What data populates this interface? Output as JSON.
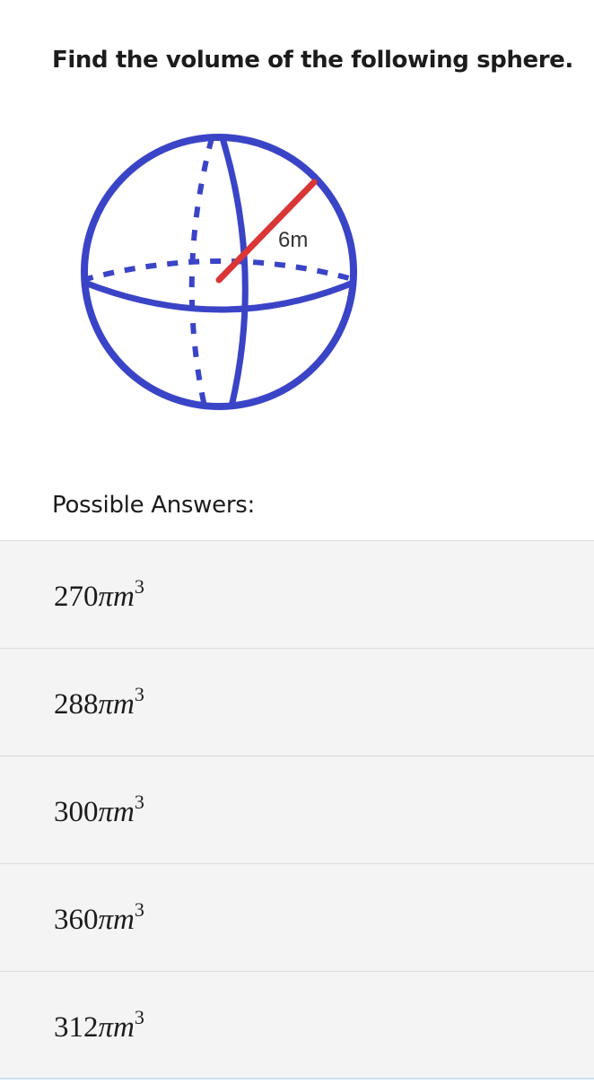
{
  "question": {
    "text": "Find the volume of the following sphere."
  },
  "figure": {
    "radius_label": "6m",
    "sphere_color": "#3a44c6",
    "radius_color": "#d93636"
  },
  "answers_label": "Possible Answers:",
  "answers": [
    {
      "coefficient": "270",
      "pi": "π",
      "unit": "m",
      "exponent": "3"
    },
    {
      "coefficient": "288",
      "pi": "π",
      "unit": "m",
      "exponent": "3"
    },
    {
      "coefficient": "300",
      "pi": "π",
      "unit": "m",
      "exponent": "3"
    },
    {
      "coefficient": "360",
      "pi": "π",
      "unit": "m",
      "exponent": "3"
    },
    {
      "coefficient": "312",
      "pi": "π",
      "unit": "m",
      "exponent": "3"
    }
  ]
}
